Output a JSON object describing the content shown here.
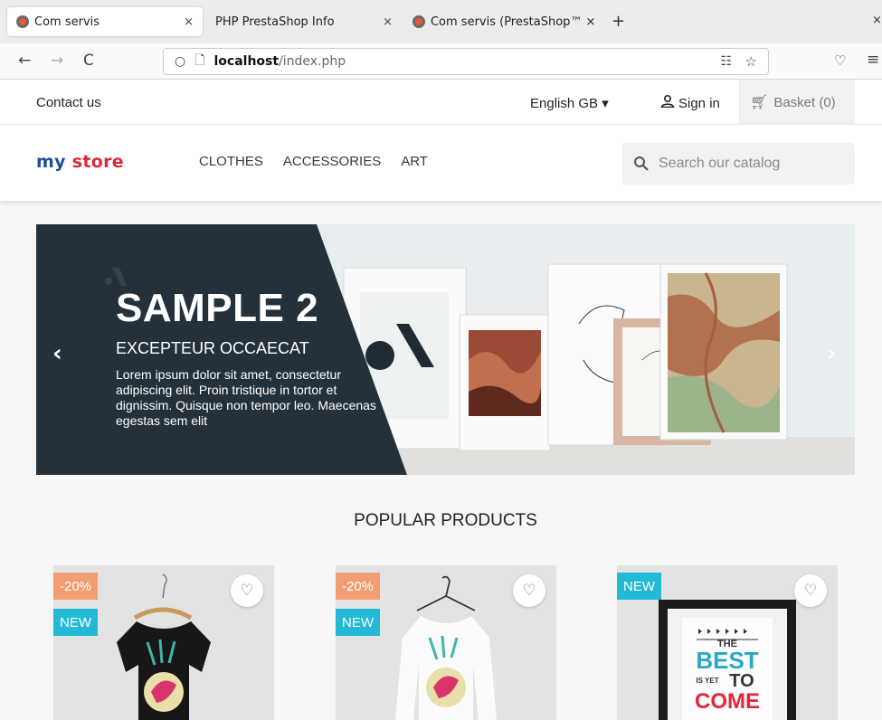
{
  "browser": {
    "tabs": [
      {
        "title": "Com servis",
        "close": "×"
      },
      {
        "title": "PHP PrestaShop Info",
        "close": "×"
      },
      {
        "title": "Com servis (PrestaShop™ ×",
        "close": ""
      }
    ],
    "new_tab": "+",
    "window_close": "×",
    "back": "←",
    "forward": "→",
    "reload": "C",
    "url_host": "localhost",
    "url_path": "/index.php"
  },
  "store": {
    "contact": "Contact us",
    "language": "English GB ▾",
    "signin": "Sign in",
    "basket": "Basket (0)",
    "logo_my": "my",
    "logo_store": "store",
    "nav": [
      "CLOTHES",
      "ACCESSORIES",
      "ART"
    ],
    "search_placeholder": "Search our catalog"
  },
  "carousel": {
    "title": "SAMPLE 2",
    "subtitle": "EXCEPTEUR OCCAECAT",
    "description": "Lorem ipsum dolor sit amet, consectetur adipiscing elit. Proin tristique in tortor et dignissim. Quisque non tempor leo. Maecenas egestas sem elit",
    "prev": "‹",
    "next": "›"
  },
  "popular": {
    "title": "POPULAR PRODUCTS",
    "products": [
      {
        "discount": "-20%",
        "flag": "NEW"
      },
      {
        "discount": "-20%",
        "flag": "NEW"
      },
      {
        "discount": "",
        "flag": "NEW",
        "poster_the": "THE",
        "poster_best": "BEST",
        "poster_isyet": "IS YET",
        "poster_to": "TO",
        "poster_come": "COME"
      }
    ]
  },
  "colors": {
    "discount_badge": "#f39d72",
    "new_badge": "#24b9d7",
    "slide_panel": "#24313b"
  }
}
